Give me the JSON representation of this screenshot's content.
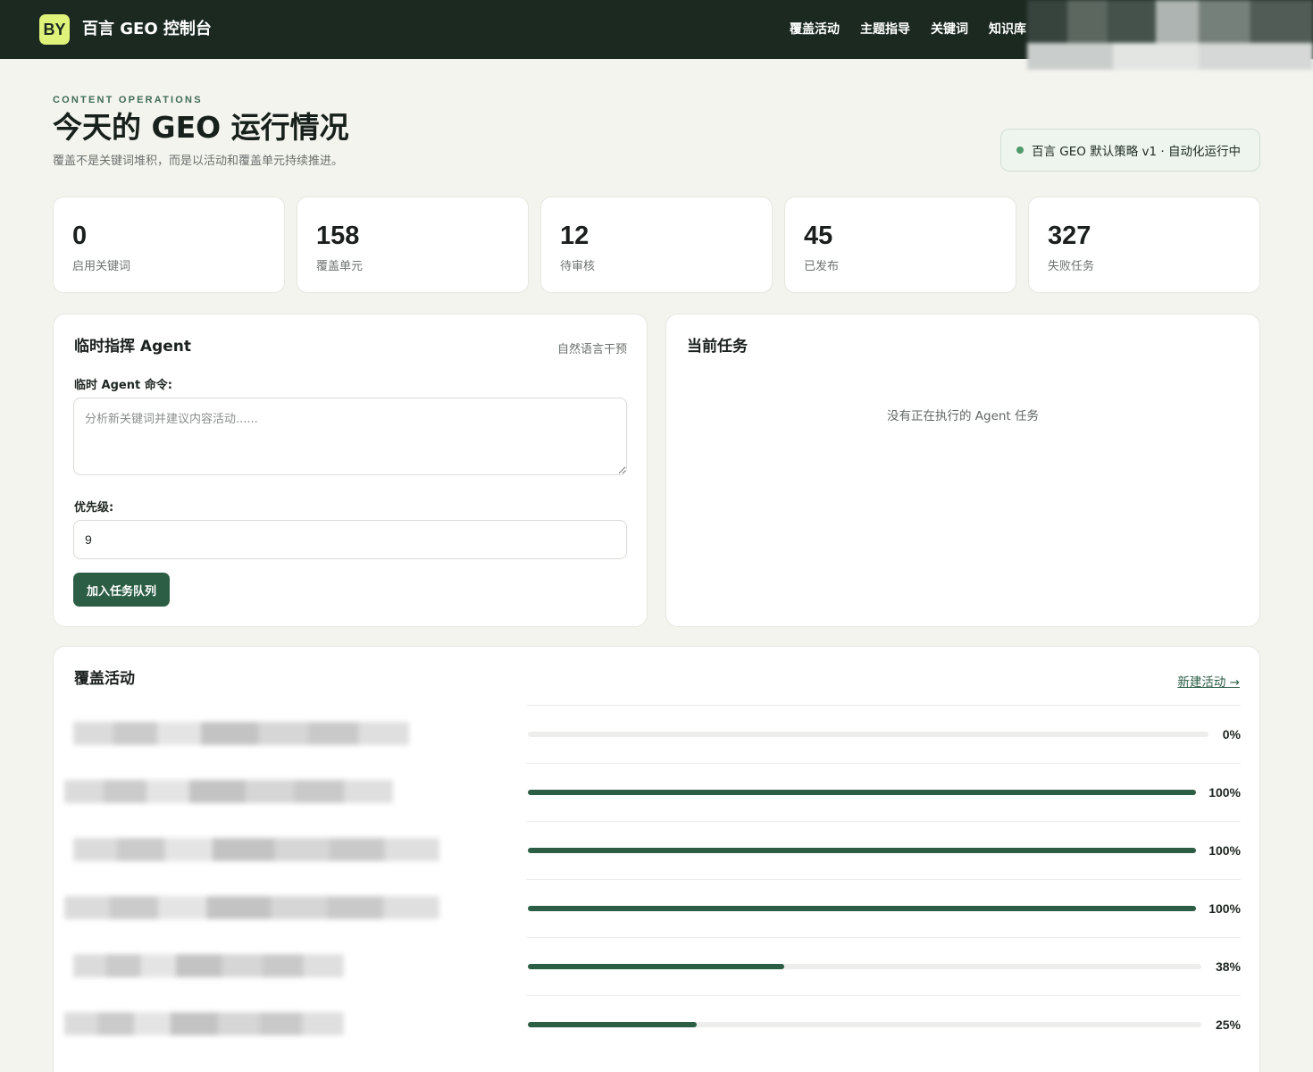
{
  "brand": {
    "logo_text": "BY",
    "title": "百言 GEO 控制台"
  },
  "nav": {
    "items": [
      "覆盖活动",
      "主题指导",
      "关键词",
      "知识库"
    ]
  },
  "header": {
    "eyebrow": "CONTENT OPERATIONS",
    "title": "今天的 GEO 运行情况",
    "subtitle": "覆盖不是关键词堆积，而是以活动和覆盖单元持续推进。",
    "strategy": "百言 GEO 默认策略 v1 · 自动化运行中"
  },
  "stats": [
    {
      "value": "0",
      "label": "启用关键词"
    },
    {
      "value": "158",
      "label": "覆盖单元"
    },
    {
      "value": "12",
      "label": "待审核"
    },
    {
      "value": "45",
      "label": "已发布"
    },
    {
      "value": "327",
      "label": "失败任务"
    }
  ],
  "agent_panel": {
    "title": "临时指挥 Agent",
    "hint": "自然语言干预",
    "command_label": "临时 Agent 命令:",
    "command_placeholder": "分析新关键词并建议内容活动......",
    "priority_label": "优先级:",
    "priority_value": "9",
    "submit_label": "加入任务队列"
  },
  "tasks_panel": {
    "title": "当前任务",
    "empty_text": "没有正在执行的 Agent 任务"
  },
  "campaigns_panel": {
    "title": "覆盖活动",
    "new_link": "新建活动 →",
    "rows": [
      {
        "progress": 0,
        "label": "0%"
      },
      {
        "progress": 100,
        "label": "100%"
      },
      {
        "progress": 100,
        "label": "100%"
      },
      {
        "progress": 100,
        "label": "100%"
      },
      {
        "progress": 38,
        "label": "38%"
      },
      {
        "progress": 25,
        "label": "25%"
      }
    ]
  },
  "colors": {
    "topbar": "#1b2921",
    "accent": "#2c5e45",
    "logo": "#dff37a",
    "status_dot": "#4e9a6b",
    "background": "#f4f4ef"
  }
}
